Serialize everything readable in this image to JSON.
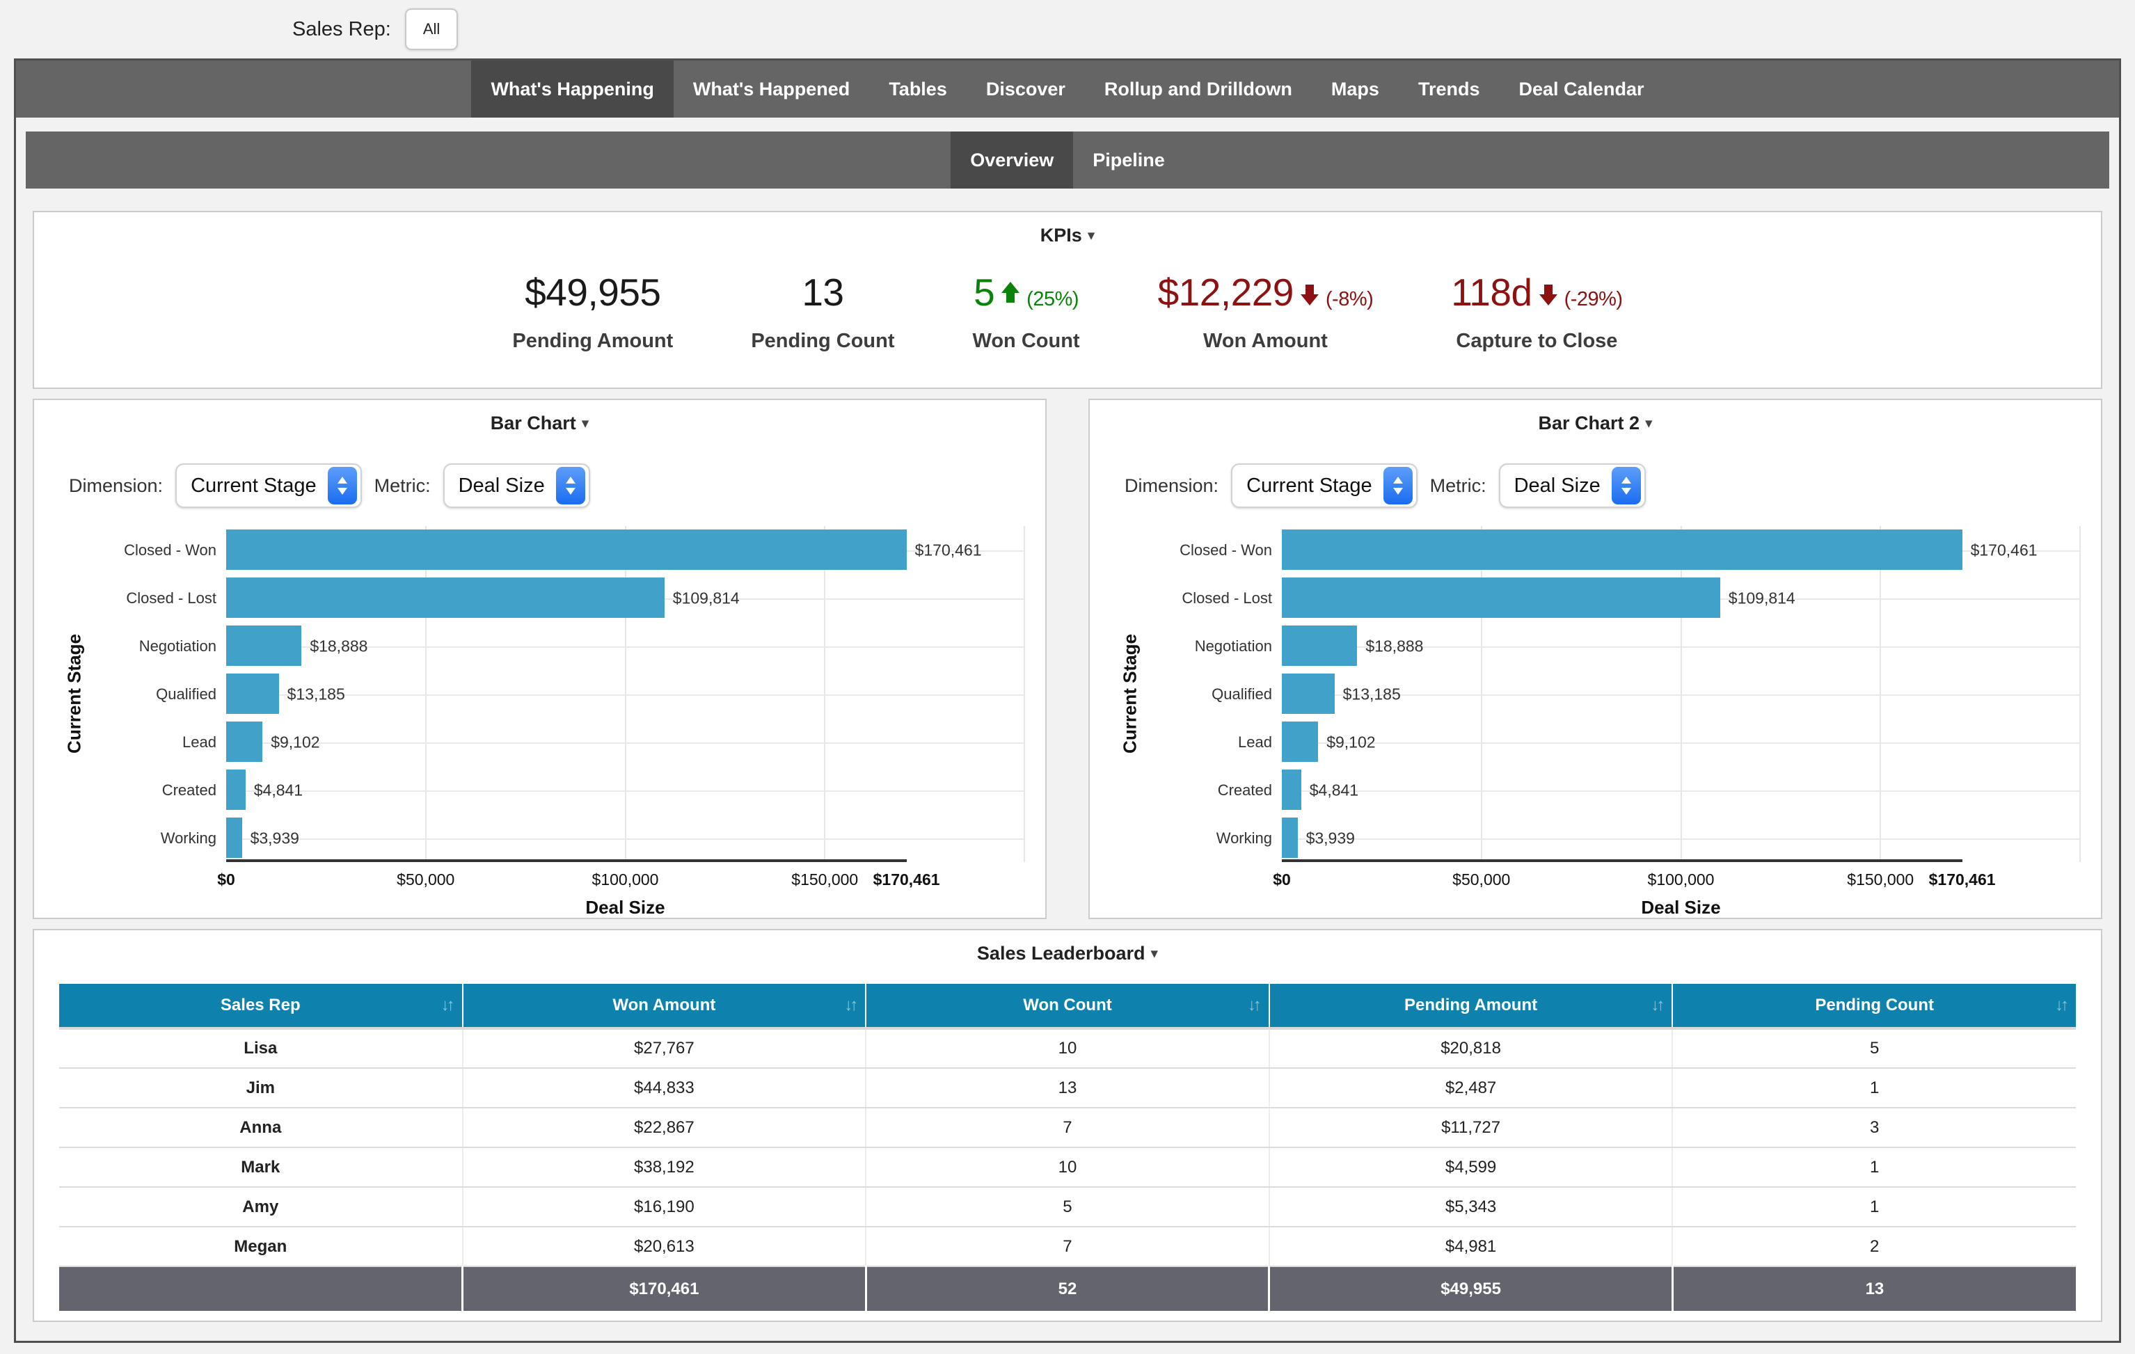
{
  "filter_bar": {
    "label": "Sales Rep:",
    "value": "All"
  },
  "nav": {
    "tabs": [
      {
        "label": "What's Happening",
        "active": true
      },
      {
        "label": "What's Happened",
        "active": false
      },
      {
        "label": "Tables",
        "active": false
      },
      {
        "label": "Discover",
        "active": false
      },
      {
        "label": "Rollup and Drilldown",
        "active": false
      },
      {
        "label": "Maps",
        "active": false
      },
      {
        "label": "Trends",
        "active": false
      },
      {
        "label": "Deal Calendar",
        "active": false
      }
    ]
  },
  "subnav": {
    "tabs": [
      {
        "label": "Overview",
        "active": true
      },
      {
        "label": "Pipeline",
        "active": false
      }
    ]
  },
  "kpis": {
    "title": "KPIs",
    "items": [
      {
        "label": "Pending Amount",
        "value": "$49,955",
        "color": "#1a1a1a"
      },
      {
        "label": "Pending Count",
        "value": "13",
        "color": "#1a1a1a"
      },
      {
        "label": "Won Count",
        "value": "5",
        "trend": "up",
        "delta": "(25%)",
        "color": "#0a830a"
      },
      {
        "label": "Won Amount",
        "value": "$12,229",
        "trend": "down",
        "delta": "(-8%)",
        "color": "#8e1111"
      },
      {
        "label": "Capture to Close",
        "value": "118d",
        "trend": "down",
        "delta": "(-29%)",
        "color": "#8e1111"
      }
    ]
  },
  "charts": [
    {
      "title": "Bar Chart",
      "dimension_label": "Dimension:",
      "dimension_value": "Current Stage",
      "metric_label": "Metric:",
      "metric_value": "Deal Size"
    },
    {
      "title": "Bar Chart 2",
      "dimension_label": "Dimension:",
      "dimension_value": "Current Stage",
      "metric_label": "Metric:",
      "metric_value": "Deal Size"
    }
  ],
  "chart_data": [
    {
      "type": "bar",
      "orientation": "horizontal",
      "title": "Bar Chart",
      "xlabel": "Deal Size",
      "ylabel": "Current Stage",
      "xlim": [
        0,
        200000
      ],
      "categories": [
        "Closed - Won",
        "Closed - Lost",
        "Negotiation",
        "Qualified",
        "Lead",
        "Created",
        "Working"
      ],
      "values": [
        170461,
        109814,
        18888,
        13185,
        9102,
        4841,
        3939
      ],
      "value_labels": [
        "$170,461",
        "$109,814",
        "$18,888",
        "$13,185",
        "$9,102",
        "$4,841",
        "$3,939"
      ],
      "xticks": [
        {
          "label": "$0",
          "value": 0,
          "bold": true
        },
        {
          "label": "$50,000",
          "value": 50000,
          "bold": false
        },
        {
          "label": "$100,000",
          "value": 100000,
          "bold": false
        },
        {
          "label": "$150,000",
          "value": 150000,
          "bold": false
        },
        {
          "label": "$170,461",
          "value": 170461,
          "bold": true
        }
      ],
      "gridline_values": [
        50000,
        100000,
        150000,
        200000
      ],
      "bar_color": "#41a1c8",
      "grid": true,
      "legend": "none"
    },
    {
      "type": "bar",
      "orientation": "horizontal",
      "title": "Bar Chart 2",
      "xlabel": "Deal Size",
      "ylabel": "Current Stage",
      "xlim": [
        0,
        200000
      ],
      "categories": [
        "Closed - Won",
        "Closed - Lost",
        "Negotiation",
        "Qualified",
        "Lead",
        "Created",
        "Working"
      ],
      "values": [
        170461,
        109814,
        18888,
        13185,
        9102,
        4841,
        3939
      ],
      "value_labels": [
        "$170,461",
        "$109,814",
        "$18,888",
        "$13,185",
        "$9,102",
        "$4,841",
        "$3,939"
      ],
      "xticks": [
        {
          "label": "$0",
          "value": 0,
          "bold": true
        },
        {
          "label": "$50,000",
          "value": 50000,
          "bold": false
        },
        {
          "label": "$100,000",
          "value": 100000,
          "bold": false
        },
        {
          "label": "$150,000",
          "value": 150000,
          "bold": false
        },
        {
          "label": "$170,461",
          "value": 170461,
          "bold": true
        }
      ],
      "gridline_values": [
        50000,
        100000,
        150000,
        200000
      ],
      "bar_color": "#41a1c8",
      "grid": true,
      "legend": "none"
    }
  ],
  "leaderboard": {
    "title": "Sales Leaderboard",
    "columns": [
      "Sales Rep",
      "Won Amount",
      "Won Count",
      "Pending Amount",
      "Pending Count"
    ],
    "rows": [
      [
        "Lisa",
        "$27,767",
        "10",
        "$20,818",
        "5"
      ],
      [
        "Jim",
        "$44,833",
        "13",
        "$2,487",
        "1"
      ],
      [
        "Anna",
        "$22,867",
        "7",
        "$11,727",
        "3"
      ],
      [
        "Mark",
        "$38,192",
        "10",
        "$4,599",
        "1"
      ],
      [
        "Amy",
        "$16,190",
        "5",
        "$5,343",
        "1"
      ],
      [
        "Megan",
        "$20,613",
        "7",
        "$4,981",
        "2"
      ]
    ],
    "total_row": [
      "",
      "$170,461",
      "52",
      "$49,955",
      "13"
    ]
  },
  "icons": {
    "caret_down": "▾",
    "sort": "↓↑"
  },
  "colors": {
    "accent_bar": "#41a1c8",
    "table_header": "#0e82ad",
    "total_row": "#63646e",
    "nav": "#656565",
    "nav_active": "#494949",
    "positive": "#0a830a",
    "negative": "#8e1111"
  }
}
